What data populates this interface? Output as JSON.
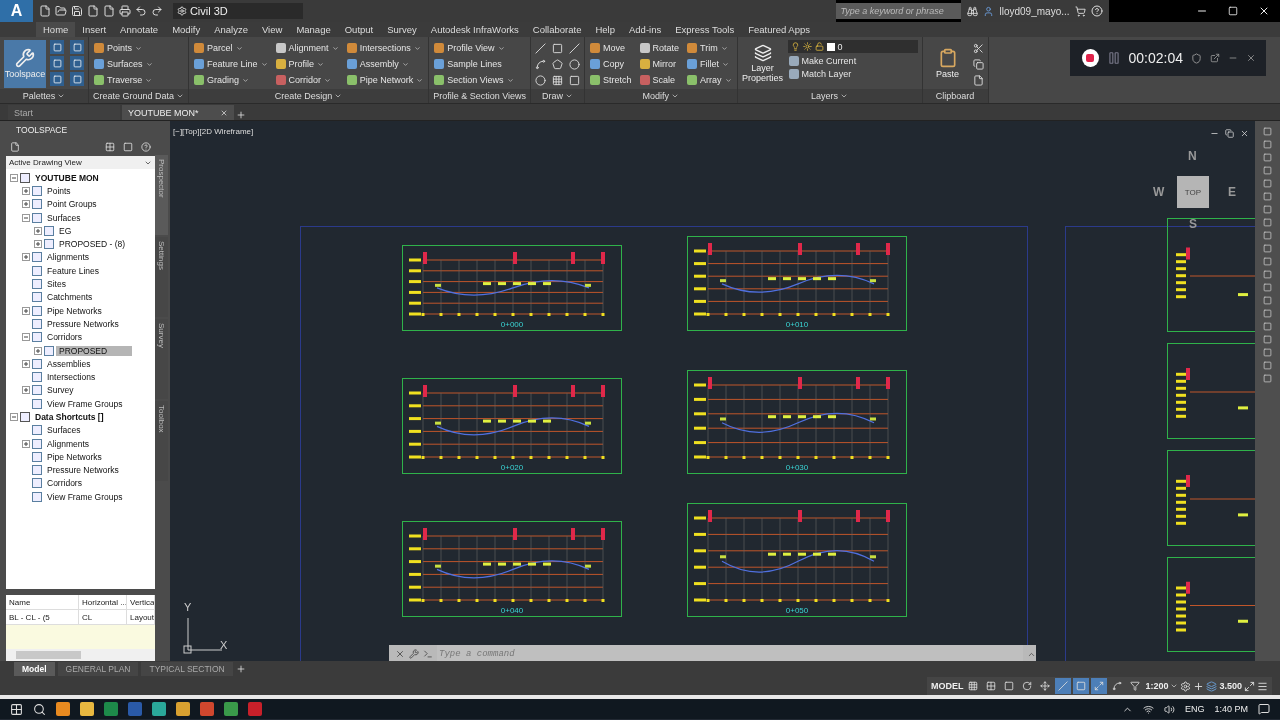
{
  "title_bar": {
    "logo": "A",
    "workspace": "Civil 3D",
    "search": {
      "placeholder": "Type a keyword or phrase"
    },
    "user": "lloyd09_mayo..."
  },
  "ribbon_tabs": [
    {
      "label": "Home",
      "selected": true
    },
    {
      "label": "Insert",
      "selected": false
    },
    {
      "label": "Annotate",
      "selected": false
    },
    {
      "label": "Modify",
      "selected": false
    },
    {
      "label": "Analyze",
      "selected": false
    },
    {
      "label": "View",
      "selected": false
    },
    {
      "label": "Manage",
      "selected": false
    },
    {
      "label": "Output",
      "selected": false
    },
    {
      "label": "Survey",
      "selected": false
    },
    {
      "label": "Autodesk InfraWorks",
      "selected": false
    },
    {
      "label": "Collaborate",
      "selected": false
    },
    {
      "label": "Help",
      "selected": false
    },
    {
      "label": "Add-ins",
      "selected": false
    },
    {
      "label": "Express Tools",
      "selected": false
    },
    {
      "label": "Featured Apps",
      "selected": false
    }
  ],
  "ribbon_panels": [
    {
      "kind": "palettes",
      "title": "Palettes",
      "dropdown": true,
      "big": {
        "label": "Toolspace",
        "selected": true
      }
    },
    {
      "kind": "tools",
      "title": "Create Ground Data",
      "dropdown": true,
      "items": [
        {
          "label": "Points",
          "dropdown": true
        },
        {
          "label": "Surfaces",
          "dropdown": true
        },
        {
          "label": "Traverse",
          "dropdown": true
        }
      ]
    },
    {
      "kind": "tools",
      "title": "Create Design",
      "dropdown": true,
      "items": [
        {
          "label": "Parcel",
          "dropdown": true
        },
        {
          "label": "Feature Line",
          "dropdown": true
        },
        {
          "label": "Grading",
          "dropdown": true
        },
        {
          "label": "Alignment",
          "dropdown": true
        },
        {
          "label": "Profile",
          "dropdown": true
        },
        {
          "label": "Corridor",
          "dropdown": true
        },
        {
          "label": "Intersections",
          "dropdown": true
        },
        {
          "label": "Assembly",
          "dropdown": true
        },
        {
          "label": "Pipe Network",
          "dropdown": true
        }
      ]
    },
    {
      "kind": "tools",
      "title": "Profile & Section Views",
      "dropdown": false,
      "items": [
        {
          "label": "Profile View",
          "dropdown": true
        },
        {
          "label": "Sample Lines",
          "dropdown": false
        },
        {
          "label": "Section Views",
          "dropdown": true
        }
      ]
    },
    {
      "kind": "draw",
      "title": "Draw",
      "dropdown": true
    },
    {
      "kind": "tools",
      "title": "Modify",
      "dropdown": true,
      "items": [
        {
          "label": "Move",
          "dropdown": false
        },
        {
          "label": "Copy",
          "dropdown": false
        },
        {
          "label": "Stretch",
          "dropdown": false
        },
        {
          "label": "Rotate",
          "dropdown": false
        },
        {
          "label": "Mirror",
          "dropdown": false
        },
        {
          "label": "Scale",
          "dropdown": false
        },
        {
          "label": "Trim",
          "dropdown": true
        },
        {
          "label": "Fillet",
          "dropdown": true
        },
        {
          "label": "Array",
          "dropdown": true
        }
      ]
    },
    {
      "kind": "layers",
      "title": "Layers",
      "dropdown": true,
      "big": {
        "label": "Layer Properties"
      },
      "layer": "0",
      "items": [
        {
          "label": "Make Current"
        },
        {
          "label": "Match Layer"
        }
      ]
    },
    {
      "kind": "clipboard",
      "title": "Clipboard",
      "dropdown": false,
      "big": {
        "label": "Paste"
      }
    }
  ],
  "file_tabs": [
    {
      "label": "Start",
      "selected": false
    },
    {
      "label": "YOUTUBE MON*",
      "selected": true
    }
  ],
  "toolspace": {
    "title": "TOOLSPACE",
    "view": "Active Drawing View",
    "tree": [
      {
        "label": "YOUTUBE MON",
        "expanded": true,
        "selected": false,
        "children": [
          {
            "label": "Points",
            "expanded": false,
            "selected": false
          },
          {
            "label": "Point Groups",
            "expanded": false,
            "selected": false
          },
          {
            "label": "Surfaces",
            "expanded": true,
            "selected": false,
            "children": [
              {
                "label": "EG",
                "expanded": false,
                "selected": false
              },
              {
                "label": "PROPOSED - (8)",
                "expanded": false,
                "selected": false
              }
            ]
          },
          {
            "label": "Alignments",
            "expanded": false,
            "selected": false
          },
          {
            "label": "Feature Lines",
            "selected": false
          },
          {
            "label": "Sites",
            "selected": false
          },
          {
            "label": "Catchments",
            "selected": false
          },
          {
            "label": "Pipe Networks",
            "expanded": false,
            "selected": false
          },
          {
            "label": "Pressure Networks",
            "selected": false
          },
          {
            "label": "Corridors",
            "expanded": true,
            "selected": false,
            "children": [
              {
                "label": "PROPOSED",
                "expanded": false,
                "selected": true
              }
            ]
          },
          {
            "label": "Assemblies",
            "expanded": false,
            "selected": false
          },
          {
            "label": "Intersections",
            "selected": false
          },
          {
            "label": "Survey",
            "expanded": false,
            "selected": false
          },
          {
            "label": "View Frame Groups",
            "selected": false
          }
        ]
      },
      {
        "label": "Data Shortcuts []",
        "expanded": true,
        "selected": false,
        "children": [
          {
            "label": "Surfaces",
            "selected": false
          },
          {
            "label": "Alignments",
            "expanded": false,
            "selected": false
          },
          {
            "label": "Pipe Networks",
            "selected": false
          },
          {
            "label": "Pressure Networks",
            "selected": false
          },
          {
            "label": "Corridors",
            "selected": false
          },
          {
            "label": "View Frame Groups",
            "selected": false
          }
        ]
      }
    ],
    "side_tabs": [
      {
        "label": "Prospector",
        "selected": true
      },
      {
        "label": "Settings",
        "selected": false
      },
      {
        "label": "Survey",
        "selected": false
      },
      {
        "label": "Toolbox",
        "selected": false
      }
    ],
    "grid": {
      "columns": [
        "Name",
        "Horizontal ...",
        "Vertica"
      ],
      "rows": [
        [
          "BL - CL - (5",
          "CL",
          "Layout"
        ]
      ]
    }
  },
  "viewport": {
    "label": "[−][Top][2D Wireframe]",
    "viewcube": {
      "north": "N",
      "south": "S",
      "east": "E",
      "west": "W",
      "face": "TOP"
    },
    "ucs": {
      "x": "X",
      "y": "Y"
    },
    "sheets": [
      {
        "station": "0+000"
      },
      {
        "station": "0+010"
      },
      {
        "station": "0+020"
      },
      {
        "station": "0+030"
      },
      {
        "station": "0+040"
      },
      {
        "station": "0+050"
      }
    ],
    "command": {
      "placeholder": "Type a command"
    }
  },
  "layout_tabs": [
    {
      "label": "Model",
      "selected": true
    },
    {
      "label": "GENERAL PLAN",
      "selected": false
    },
    {
      "label": "TYPICAL SECTION",
      "selected": false
    }
  ],
  "status_bar": {
    "space": "MODEL",
    "scale": "1:200",
    "weight": "3.500",
    "toggles": [
      {
        "on": false
      },
      {
        "on": false
      },
      {
        "on": false
      },
      {
        "on": false
      },
      {
        "on": false
      },
      {
        "on": true
      },
      {
        "on": true
      },
      {
        "on": true
      },
      {
        "on": false
      },
      {
        "on": false
      }
    ]
  },
  "recorder": {
    "time": "00:02:04"
  },
  "taskbar": {
    "language": "ENG",
    "time": "1:40 PM"
  }
}
